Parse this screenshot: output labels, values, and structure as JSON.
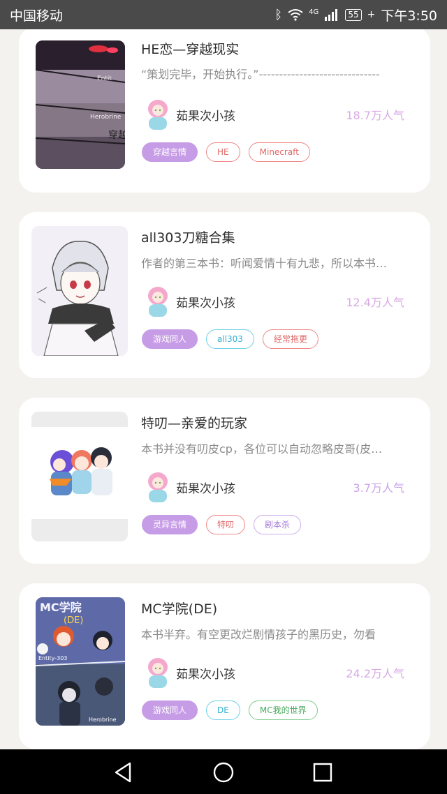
{
  "status_bar": {
    "carrier": "中国移动",
    "network": "4G",
    "battery": "55",
    "time": "下午3:50"
  },
  "books": [
    {
      "title": "HE恋—穿越现实",
      "description": "“策划完毕，开始执行。”------------------------------",
      "author": "茹果次小孩",
      "popularity": "18.7万人气",
      "popularity_color": "#d8a8e4",
      "tags": [
        "穿越言情",
        "HE",
        "Minecraft"
      ],
      "cover_text": [
        "Entit",
        "Herobrine",
        "穿越"
      ]
    },
    {
      "title": "all303刀糖合集",
      "description": "作者的第三本书：听闻爱情十有九悲，所以本书…",
      "author": "茹果次小孩",
      "popularity": "12.4万人气",
      "popularity_color": "#d8a8e4",
      "tags": [
        "游戏同人",
        "all303",
        "经常拖更"
      ]
    },
    {
      "title": "特叨—亲爱的玩家",
      "description": "本书并没有叨皮cp，各位可以自动忽略皮哥(皮…",
      "author": "茹果次小孩",
      "popularity": "3.7万人气",
      "popularity_color": "#c8a2e8",
      "tags": [
        "灵异言情",
        "特叨",
        "剧本杀"
      ]
    },
    {
      "title": "MC学院(DE)",
      "description": "本书半弃。有空更改烂剧情孩子的黑历史，勿看",
      "author": "茹果次小孩",
      "popularity": "24.2万人气",
      "popularity_color": "#d8a8e4",
      "tags": [
        "游戏同人",
        "DE",
        "MC我的世界"
      ],
      "cover_text": [
        "MC学院",
        "(DE)",
        "Entity-303",
        "Herobrine"
      ]
    }
  ]
}
